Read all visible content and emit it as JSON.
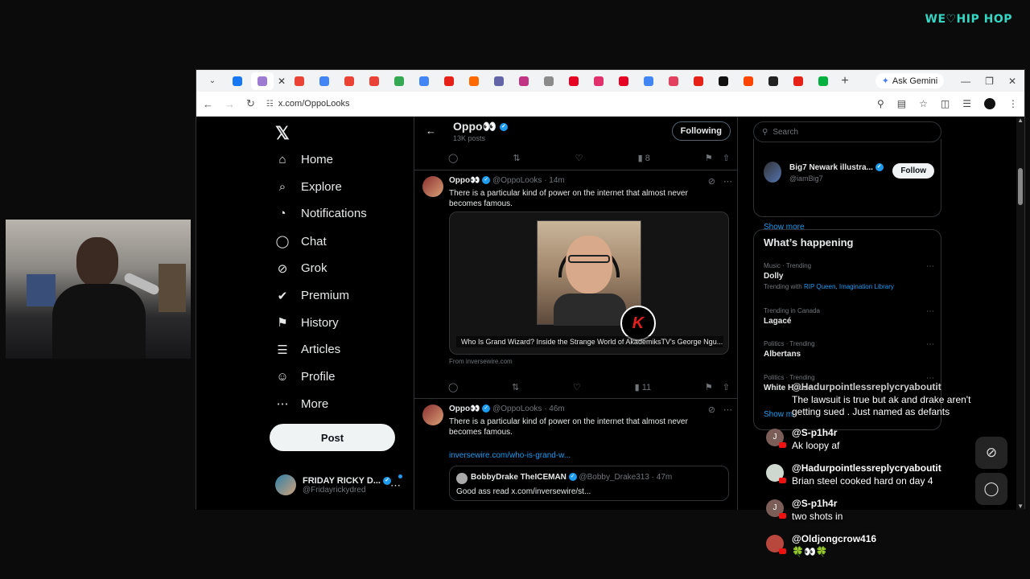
{
  "brand": {
    "logo_text": "WE♡HIP HOP"
  },
  "browser": {
    "tabs_active_close": "✕",
    "gemini_label": "Ask Gemini",
    "url": "x.com/OppoLooks",
    "tab_colors": [
      "#1877f2",
      "#9c7bd1",
      "#ea4335",
      "#4285f4",
      "#ea4335",
      "#ea4335",
      "#34a853",
      "#4285f4",
      "#e62117",
      "#ff6a00",
      "#6264a7",
      "#c13584",
      "#8b8b8b",
      "#e60023",
      "#e1306c",
      "#e60023",
      "#4285f4",
      "#e4405f",
      "#e62117",
      "#111111",
      "#ff4500",
      "#222222",
      "#e62117",
      "#00b140"
    ]
  },
  "nav": {
    "items": [
      {
        "label": "Home",
        "icon": "⌂"
      },
      {
        "label": "Explore",
        "icon": "⌕"
      },
      {
        "label": "Notifications",
        "icon": "◔"
      },
      {
        "label": "Chat",
        "icon": "◯"
      },
      {
        "label": "Grok",
        "icon": "⊘"
      },
      {
        "label": "Premium",
        "icon": "✔"
      },
      {
        "label": "History",
        "icon": "⚑"
      },
      {
        "label": "Articles",
        "icon": "☰"
      },
      {
        "label": "Profile",
        "icon": "☺"
      },
      {
        "label": "More",
        "icon": "⋯"
      }
    ],
    "post_label": "Post",
    "account_name": "FRIDAY RICKY D...",
    "account_handle": "@Fridayrickydred"
  },
  "profile": {
    "title": "Oppo👀",
    "posts": "13K posts",
    "following_label": "Following"
  },
  "tweets": [
    {
      "name": "Oppo👀",
      "handle": "@OppoLooks · 14m",
      "text": "There is a particular kind of power on the internet that almost never becomes famous.",
      "card_caption": "Who Is Grand Wizard? Inside the Strange World of AkademiksTV's George Ngu...",
      "card_logo": "K",
      "from": "From inversewire.com",
      "views": "11"
    },
    {
      "name": "Oppo👀",
      "handle": "@OppoLooks · 46m",
      "text": "There is a particular kind of power on the internet that almost never becomes famous.",
      "link": "inversewire.com/who-is-grand-w...",
      "quote_name": "BobbyDrake TheICEMAN",
      "quote_handle": "@Bobby_Drake313 · 47m",
      "quote_text": "Good ass read x.com/inversewire/st..."
    }
  ],
  "top_actions_views": "8",
  "right": {
    "search_placeholder": "Search",
    "who_name": "Big7 Newark illustra...",
    "who_handle": "@iamBig7",
    "follow_label": "Follow",
    "show_more": "Show more",
    "happening_title": "What’s happening",
    "trends": [
      {
        "category": "Music · Trending",
        "name": "Dolly",
        "with_prefix": "Trending with",
        "with_links": "RIP Queen, Imagination Library"
      },
      {
        "category": "Trending in Canada",
        "name": "Lagacé"
      },
      {
        "category": "Politics · Trending",
        "name": "Albertans"
      },
      {
        "category": "Politics · Trending",
        "name": "White House"
      }
    ],
    "show_more_2": "Show m"
  },
  "chat": [
    {
      "user": "@Hadurpointlessreplycryaboutit",
      "text": "The lawsuit is true but ak and drake aren't\ngetting sued . Just named as defants",
      "avatar": ""
    },
    {
      "user": "@S-p1h4r",
      "text": "Ak loopy af",
      "avatar": "J"
    },
    {
      "user": "@Hadurpointlessreplycryaboutit",
      "text": "Brian steel cooked hard on day 4",
      "avatar": ""
    },
    {
      "user": "@S-p1h4r",
      "text": "two shots in",
      "avatar": "J"
    },
    {
      "user": "@Oldjongcrow416",
      "text": "🍀👀🍀",
      "avatar": ""
    }
  ]
}
